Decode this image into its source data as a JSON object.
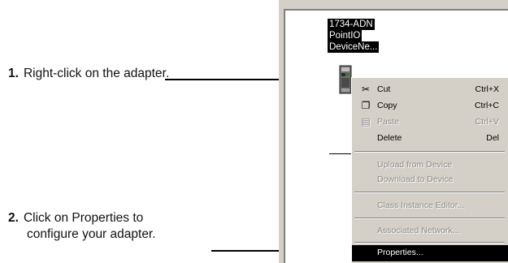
{
  "steps": [
    {
      "num": "1.",
      "text": "Right-click on the adapter."
    },
    {
      "num": "2.",
      "text_line1": "Click on Properties to",
      "text_line2": "configure your adapter."
    }
  ],
  "node": {
    "line1": "1734-ADN",
    "line2": "PointIO",
    "line3": "DeviceNe..."
  },
  "menu": {
    "cut": {
      "label": "Cut",
      "shortcut": "Ctrl+X",
      "icon": "scissors-icon"
    },
    "copy": {
      "label": "Copy",
      "shortcut": "Ctrl+C",
      "icon": "copy-icon"
    },
    "paste": {
      "label": "Paste",
      "shortcut": "Ctrl+V",
      "icon": "paste-icon"
    },
    "delete": {
      "label": "Delete",
      "shortcut": "Del"
    },
    "upload": {
      "label": "Upload from Device"
    },
    "download": {
      "label": "Download to Device"
    },
    "class_instance": {
      "label": "Class Instance Editor..."
    },
    "associated": {
      "label": "Associated Network..."
    },
    "properties": {
      "label": "Properties..."
    }
  },
  "colors": {
    "menu_bg": "#d4d0c8",
    "selected_bg": "#000000",
    "disabled_text": "#8a8a8a"
  }
}
